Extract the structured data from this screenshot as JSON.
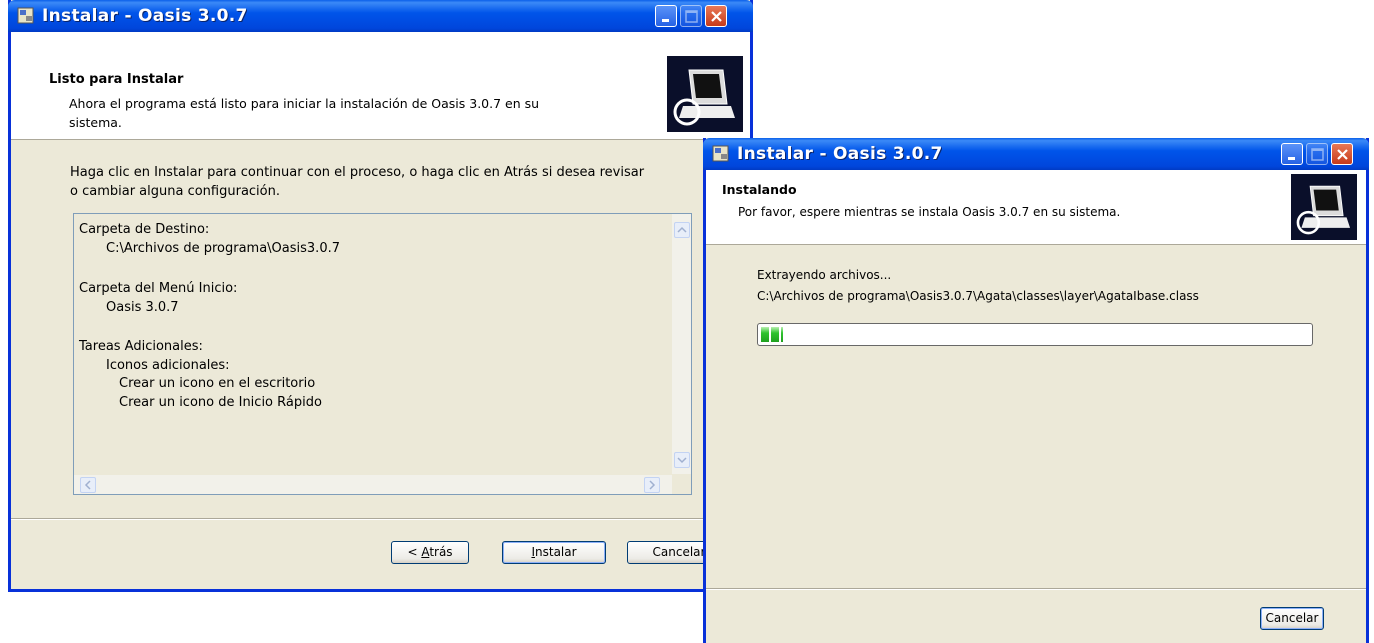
{
  "window1": {
    "title": "Instalar - Oasis  3.0.7",
    "header_title": "Listo para Instalar",
    "header_subtitle_1": "Ahora el programa está listo para iniciar la instalación de Oasis  3.0.7 en su",
    "header_subtitle_2": "sistema.",
    "instructions_1": "Haga clic en Instalar para continuar con el proceso, o haga clic en Atrás si desea revisar",
    "instructions_2": "o cambiar alguna configuración.",
    "summary_lines": [
      "Carpeta de Destino:",
      "C:\\Archivos de programa\\Oasis3.0.7",
      "Carpeta del Menú Inicio:",
      "Oasis 3.0.7",
      "Tareas Adicionales:",
      "Iconos adicionales:",
      "Crear un icono en el escritorio",
      "Crear un icono de Inicio Rápido"
    ],
    "buttons": {
      "back": "< Atrás",
      "install": "Instalar",
      "cancel": "Cancelar"
    }
  },
  "window2": {
    "title": "Instalar - Oasis  3.0.7",
    "header_title": "Instalando",
    "header_subtitle": "Por favor, espere mientras se instala Oasis  3.0.7 en su sistema.",
    "status": "Extrayendo archivos...",
    "file_path": "C:\\Archivos de programa\\Oasis3.0.7\\Agata\\classes\\layer\\AgataIbase.class",
    "progress_fraction": 0.04,
    "buttons": {
      "cancel": "Cancelar"
    }
  },
  "icons": [
    "installer-app-icon",
    "minimize-icon",
    "maximize-icon",
    "close-icon",
    "setup-computer-icon",
    "scroll-up-icon",
    "scroll-down-icon",
    "scroll-left-icon",
    "scroll-right-icon"
  ],
  "colors": {
    "titlebar": "#0055ea",
    "dialog_bg": "#ece9d8",
    "progress_green": "#2fc32f",
    "close": "#c63a1b"
  }
}
